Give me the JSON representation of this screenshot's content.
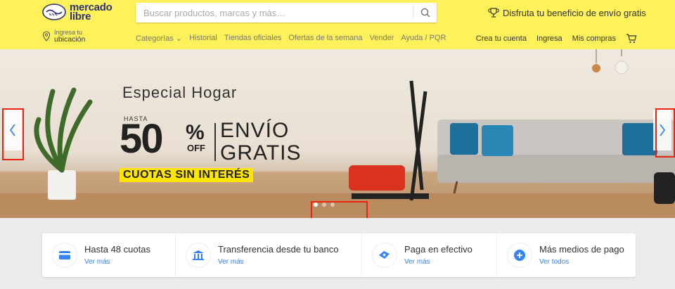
{
  "header": {
    "logo_line1": "mercado",
    "logo_line2": "libre",
    "search_placeholder": "Buscar productos, marcas y más…",
    "promo_text": "Disfruta tu beneficio de envío gratis",
    "location_line1": "Ingresa tu",
    "location_line2": "ubicación",
    "nav": [
      "Categorías ⌄",
      "Historial",
      "Tiendas oficiales",
      "Ofertas de la semana",
      "Vender",
      "Ayuda / PQR"
    ],
    "user_nav": [
      "Crea tu cuenta",
      "Ingresa",
      "Mis compras"
    ]
  },
  "banner": {
    "title": "Especial Hogar",
    "hasta": "HASTA",
    "percent": "50",
    "percent_sign": "%",
    "off": "OFF",
    "envio_line1": "ENVÍO",
    "envio_line2": "GRATIS",
    "cuotas": "CUOTAS SIN INTERÉS",
    "slides": 3,
    "active_slide": 1
  },
  "payments": [
    {
      "title": "Hasta 48 cuotas",
      "link": "Ver más",
      "icon": "credit-card-icon"
    },
    {
      "title": "Transferencia desde tu banco",
      "link": "Ver más",
      "icon": "bank-icon"
    },
    {
      "title": "Paga en efectivo",
      "link": "Ver más",
      "icon": "cash-icon"
    },
    {
      "title": "Más medios de pago",
      "link": "Ver todos",
      "icon": "plus-icon"
    }
  ],
  "colors": {
    "header_bg": "#fff159",
    "accent_yellow": "#ffe600",
    "link_blue": "#3483fa",
    "highlight_red": "#e21111"
  }
}
